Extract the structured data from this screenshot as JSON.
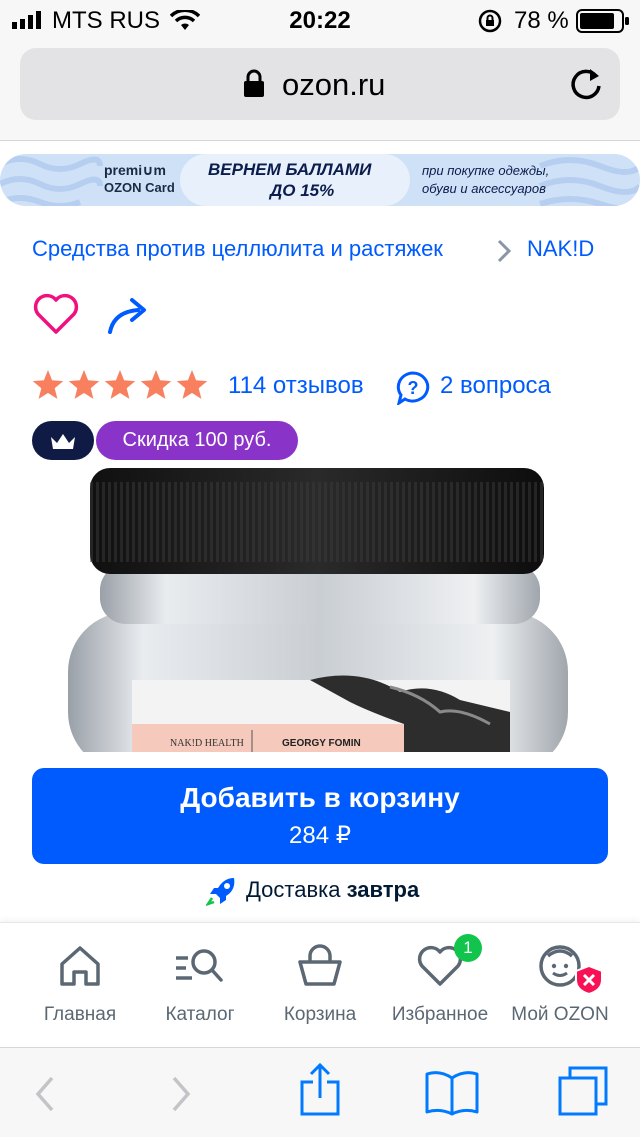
{
  "status_bar": {
    "carrier": "MTS RUS",
    "time": "20:22",
    "battery_percent": "78 %"
  },
  "browser": {
    "url": "ozon.ru"
  },
  "banner": {
    "brand_line1": "premi∪m",
    "brand_line2": "OZON Card",
    "headline_line1": "ВЕРНЕМ БАЛЛАМИ",
    "headline_line2": "ДО 15%",
    "side_line1": "при покупке одежды,",
    "side_line2": "обуви и аксессуаров"
  },
  "breadcrumb": {
    "category": "Средства против целлюлита и растяжек",
    "brand": "NAK!D"
  },
  "product": {
    "rating_stars": 5,
    "reviews": "114 отзывов",
    "questions": "2 вопроса",
    "discount_badge": "Скидка 100 руб.",
    "label_left": "NAK!D HEALTH",
    "label_right": "GEORGY FOMIN"
  },
  "cart_button": {
    "label": "Добавить в корзину",
    "price": "284 ₽"
  },
  "delivery": {
    "prefix": "Доставка",
    "when": "завтра"
  },
  "tab_bar": {
    "tabs": [
      {
        "label": "Главная",
        "icon": "home-icon"
      },
      {
        "label": "Каталог",
        "icon": "catalog-search-icon"
      },
      {
        "label": "Корзина",
        "icon": "basket-icon"
      },
      {
        "label": "Избранное",
        "icon": "heart-icon",
        "badge": "1"
      },
      {
        "label": "Мой OZON",
        "icon": "profile-icon"
      }
    ]
  },
  "colors": {
    "ozon_blue": "#005bff",
    "star": "#f9805f",
    "discount_purple": "#8a33c9",
    "crown_navy": "#0f1b44",
    "heart_red": "#f1117e",
    "badge_green": "#10c44c"
  }
}
